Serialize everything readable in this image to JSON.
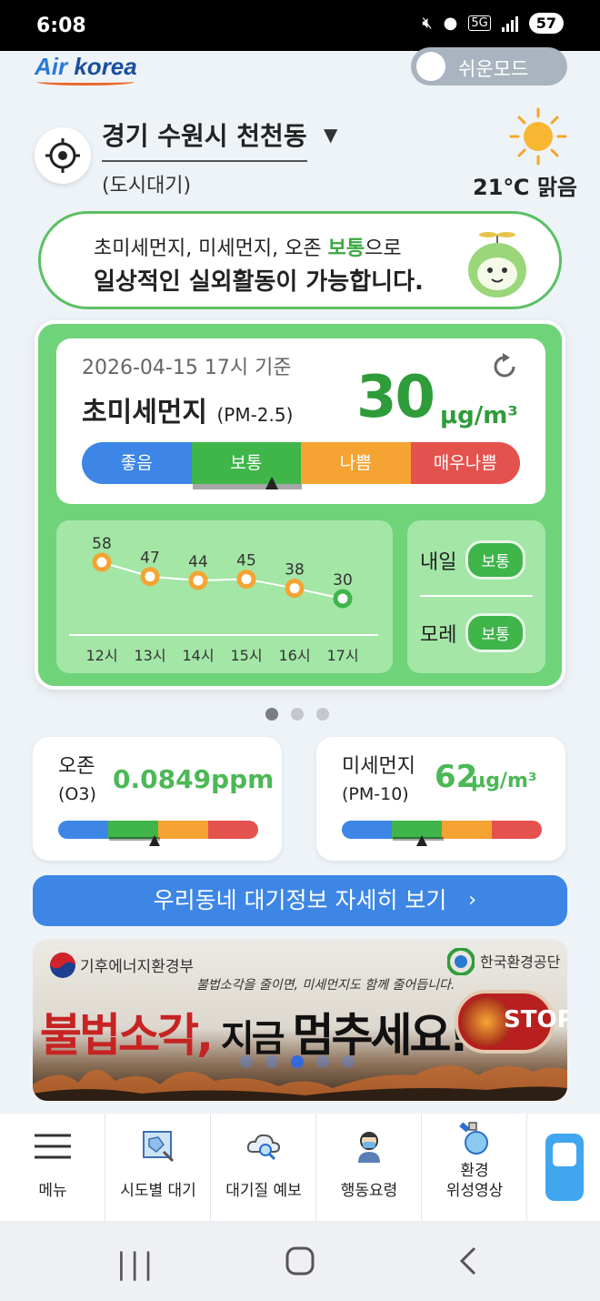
{
  "status_bar": {
    "time": "6:08",
    "network": "5G",
    "battery": "57"
  },
  "header": {
    "logo": "Airkorea",
    "easy_mode_label": "쉬운모드"
  },
  "location": {
    "name": "경기 수원시 천천동",
    "type": "(도시대기)"
  },
  "weather": {
    "temp_condition": "21℃ 맑음",
    "icon": "sun-icon"
  },
  "message": {
    "line1_prefix": "초미세먼지, 미세먼지, 오존 ",
    "line1_highlight": "보통",
    "line1_suffix": "으로",
    "line2": "일상적인 실외활동이 가능합니다."
  },
  "pm25": {
    "timestamp": "2026-04-15 17시 기준",
    "title": "초미세먼지",
    "subtitle": "(PM-2.5)",
    "value": "30",
    "unit": "μg/m³",
    "scale_labels": [
      "좋음",
      "보통",
      "나쁨",
      "매우나쁨"
    ],
    "current_level_index": 1
  },
  "trend": {
    "hours": [
      "12시",
      "13시",
      "14시",
      "15시",
      "16시",
      "17시"
    ],
    "values": [
      58,
      47,
      44,
      45,
      38,
      30
    ]
  },
  "forecast": [
    {
      "day": "내일",
      "level": "보통"
    },
    {
      "day": "모레",
      "level": "보통"
    }
  ],
  "carousel": {
    "pages": 3,
    "active": 0
  },
  "ozone": {
    "label": "오존",
    "sub": "(O3)",
    "value": "0.0849ppm",
    "level_index": 1,
    "level_fraction": 0.48
  },
  "pm10": {
    "label": "미세먼지",
    "sub": "(PM-10)",
    "value": "62",
    "unit": "μg/m³",
    "level_index": 1,
    "level_fraction": 0.4
  },
  "detail_button": {
    "label": "우리동네 대기정보 자세히 보기",
    "arrow": "›"
  },
  "banner": {
    "org_left": "기후에너지환경부",
    "org_right": "한국환경공단",
    "sub": "불법소각을 줄이면, 미세먼지도 함께 줄어듭니다.",
    "main_red": "불법소각,",
    "main_mid": " 지금 ",
    "main_end": "멈추세요!",
    "stop": "STOP",
    "pages": 5,
    "active": 2
  },
  "bottom_nav": [
    {
      "label": "메뉴",
      "icon": "menu-icon"
    },
    {
      "label": "시도별 대기",
      "icon": "map-icon"
    },
    {
      "label": "대기질 예보",
      "icon": "cloud-search-icon"
    },
    {
      "label": "행동요령",
      "icon": "mask-person-icon"
    },
    {
      "label": "환경\n위성영상",
      "icon": "satellite-icon"
    }
  ],
  "colors": {
    "good": "#3d86e6",
    "normal": "#3fb54a",
    "bad": "#f5a332",
    "very_bad": "#e4524e",
    "accent": "#2f9c3a"
  }
}
